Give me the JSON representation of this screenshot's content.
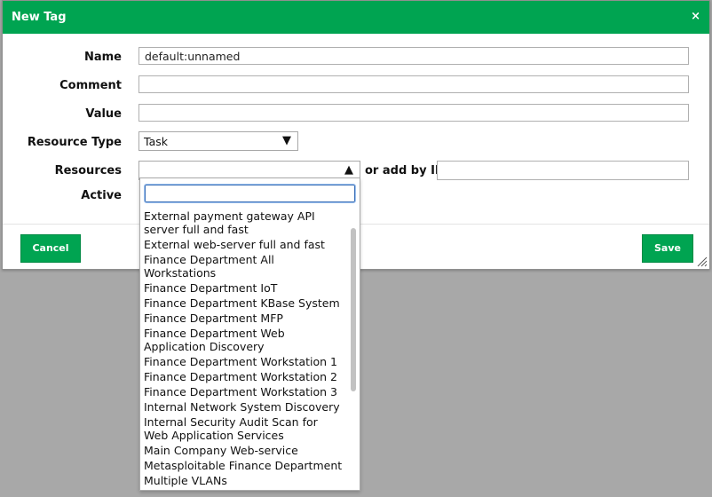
{
  "dialog": {
    "title": "New Tag",
    "close_label": "×"
  },
  "form": {
    "name_label": "Name",
    "name_value": "default:unnamed",
    "comment_label": "Comment",
    "comment_value": "",
    "value_label": "Value",
    "value_value": "",
    "resource_type_label": "Resource Type",
    "resource_type_value": "Task",
    "resources_label": "Resources",
    "resources_value": "",
    "add_by_id_label": "or add by ID:",
    "add_by_id_value": "",
    "active_label": "Active"
  },
  "buttons": {
    "cancel": "Cancel",
    "save": "Save"
  },
  "dropdown": {
    "search_value": "",
    "items": [
      "External payment gateway API server full and fast",
      "External web-server full and fast",
      "Finance Department All Workstations",
      "Finance Department IoT",
      "Finance Department KBase System",
      "Finance Department MFP",
      "Finance Department Web Application Discovery",
      "Finance Department Workstation 1",
      "Finance Department Workstation 2",
      "Finance Department Workstation 3",
      "Internal Network System Discovery",
      "Internal Security Audit Scan for Web Application Services",
      "Main Company Web-service",
      "Metasploitable Finance Department",
      "Multiple VLANs"
    ]
  },
  "colors": {
    "accent": "#00a451",
    "overlay": "#a8a8a8"
  },
  "icons": {
    "close": "close-icon",
    "select_arrow": "triangle-down-icon",
    "resources_arrow": "triangle-up-icon",
    "resize": "resize-grip-icon"
  }
}
